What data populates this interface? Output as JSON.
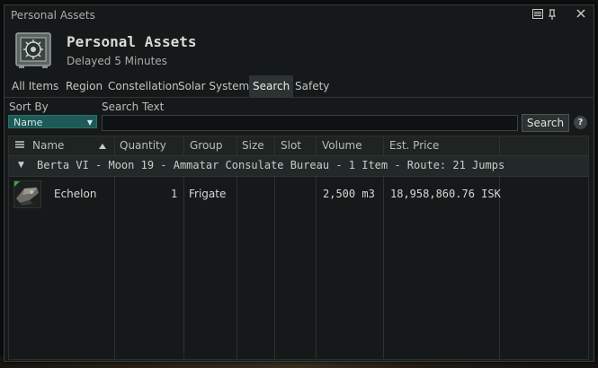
{
  "window": {
    "title": "Personal Assets",
    "controls": [
      "compact-icon",
      "pin-icon",
      "close-icon"
    ]
  },
  "header": {
    "title": "Personal Assets",
    "subtitle": "Delayed 5 Minutes",
    "icon": "safe-icon"
  },
  "tabs": [
    {
      "label": "All Items"
    },
    {
      "label": "Region"
    },
    {
      "label": "Constellation"
    },
    {
      "label": "Solar System"
    },
    {
      "label": "Search",
      "active": true
    },
    {
      "label": "Safety"
    }
  ],
  "search": {
    "sort_label": "Sort By",
    "sort_value": "Name",
    "text_label": "Search Text",
    "text_value": "",
    "button_label": "Search",
    "help_label": "?"
  },
  "table": {
    "columns": [
      {
        "label": "Name"
      },
      {
        "label": "Quantity"
      },
      {
        "label": "Group"
      },
      {
        "label": "Size"
      },
      {
        "label": "Slot"
      },
      {
        "label": "Volume"
      },
      {
        "label": "Est. Price"
      }
    ],
    "group": {
      "text": "Berta VI - Moon 19 - Ammatar Consulate Bureau - 1 Item - Route: 21 Jumps"
    },
    "rows": [
      {
        "name": "Echelon",
        "quantity": "1",
        "group": "Frigate",
        "size": "",
        "slot": "",
        "volume": "2,500 m3",
        "price": "18,958,860.76 ISK"
      }
    ]
  },
  "colors": {
    "accent": "#1d5a58",
    "active_tab": "#2c3332",
    "window_bg": "#161919"
  }
}
